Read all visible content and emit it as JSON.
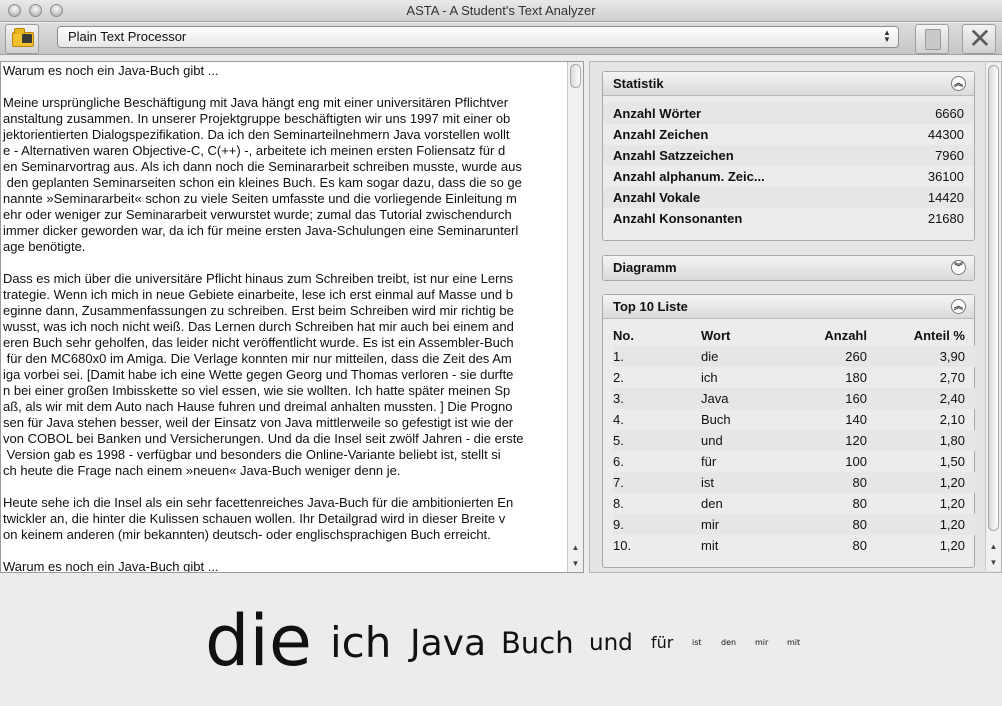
{
  "window": {
    "title": "ASTA - A Student's Text Analyzer"
  },
  "toolbar": {
    "open_icon": "folder-icon",
    "processor_value": "Plain Text Processor",
    "doc_icon": "document-icon",
    "close_icon": "close-icon"
  },
  "text": {
    "paragraphs": [
      "Warum es noch ein Java-Buch gibt ...",
      "Meine ursprüngliche Beschäftigung mit Java hängt eng mit einer universitären Pflichtver\nanstaltung zusammen. In unserer Projektgruppe beschäftigten wir uns 1997 mit einer ob\njektorientierten Dialogspezifikation. Da ich den Seminarteilnehmern Java vorstellen wollt\ne - Alternativen waren Objective-C, C(++) -, arbeitete ich meinen ersten Foliensatz für d\nen Seminarvortrag aus. Als ich dann noch die Seminararbeit schreiben musste, wurde aus\n den geplanten Seminarseiten schon ein kleines Buch. Es kam sogar dazu, dass die so ge\nnannte »Seminararbeit« schon zu viele Seiten umfasste und die vorliegende Einleitung m\nehr oder weniger zur Seminararbeit verwurstet wurde; zumal das Tutorial zwischendurch\nimmer dicker geworden war, da ich für meine ersten Java-Schulungen eine Seminarunterl\nage benötigte.",
      "Dass es mich über die universitäre Pflicht hinaus zum Schreiben treibt, ist nur eine Lerns\ntrategie. Wenn ich mich in neue Gebiete einarbeite, lese ich erst einmal auf Masse und b\neginne dann, Zusammenfassungen zu schreiben. Erst beim Schreiben wird mir richtig be\nwusst, was ich noch nicht weiß. Das Lernen durch Schreiben hat mir auch bei einem and\neren Buch sehr geholfen, das leider nicht veröffentlicht wurde. Es ist ein Assembler-Buch\n für den MC680x0 im Amiga. Die Verlage konnten mir nur mitteilen, dass die Zeit des Am\niga vorbei sei. [Damit habe ich eine Wette gegen Georg und Thomas verloren - sie durfte\nn bei einer großen Imbisskette so viel essen, wie sie wollten. Ich hatte später meinen Sp\naß, als wir mit dem Auto nach Hause fuhren und dreimal anhalten mussten. ] Die Progno\nsen für Java stehen besser, weil der Einsatz von Java mittlerweile so gefestigt ist wie der\nvon COBOL bei Banken und Versicherungen. Und da die Insel seit zwölf Jahren - die erste\n Version gab es 1998 - verfügbar und besonders die Online-Variante beliebt ist, stellt si\nch heute die Frage nach einem »neuen« Java-Buch weniger denn je.",
      "Heute sehe ich die Insel als ein sehr facettenreiches Java-Buch für die ambitionierten En\ntwickler an, die hinter die Kulissen schauen wollen. Ihr Detailgrad wird in dieser Breite v\non keinem anderen (mir bekannten) deutsch- oder englischsprachigen Buch erreicht.",
      "Warum es noch ein Java-Buch gibt ..."
    ]
  },
  "statistik": {
    "title": "Statistik",
    "rows": [
      {
        "label": "Anzahl Wörter",
        "value": "6660"
      },
      {
        "label": "Anzahl Zeichen",
        "value": "44300"
      },
      {
        "label": "Anzahl Satzzeichen",
        "value": "7960"
      },
      {
        "label": "Anzahl alphanum. Zeic...",
        "value": "36100"
      },
      {
        "label": "Anzahl Vokale",
        "value": "14420"
      },
      {
        "label": "Anzahl Konsonanten",
        "value": "21680"
      }
    ]
  },
  "diagramm": {
    "title": "Diagramm"
  },
  "top10": {
    "title": "Top 10 Liste",
    "headers": {
      "no": "No.",
      "wort": "Wort",
      "anzahl": "Anzahl",
      "anteil": "Anteil %"
    },
    "rows": [
      {
        "no": "1.",
        "wort": "die",
        "anzahl": "260",
        "anteil": "3,90"
      },
      {
        "no": "2.",
        "wort": "ich",
        "anzahl": "180",
        "anteil": "2,70"
      },
      {
        "no": "3.",
        "wort": "Java",
        "anzahl": "160",
        "anteil": "2,40"
      },
      {
        "no": "4.",
        "wort": "Buch",
        "anzahl": "140",
        "anteil": "2,10"
      },
      {
        "no": "5.",
        "wort": "und",
        "anzahl": "120",
        "anteil": "1,80"
      },
      {
        "no": "6.",
        "wort": "für",
        "anzahl": "100",
        "anteil": "1,50"
      },
      {
        "no": "7.",
        "wort": "ist",
        "anzahl": "80",
        "anteil": "1,20"
      },
      {
        "no": "8.",
        "wort": "den",
        "anzahl": "80",
        "anteil": "1,20"
      },
      {
        "no": "9.",
        "wort": "mir",
        "anzahl": "80",
        "anteil": "1,20"
      },
      {
        "no": "10.",
        "wort": "mit",
        "anzahl": "80",
        "anteil": "1,20"
      }
    ]
  },
  "cloud": {
    "words": [
      "die",
      "ich",
      "Java",
      "Buch",
      "und",
      "für",
      "ist",
      "den",
      "mir",
      "mit"
    ]
  }
}
